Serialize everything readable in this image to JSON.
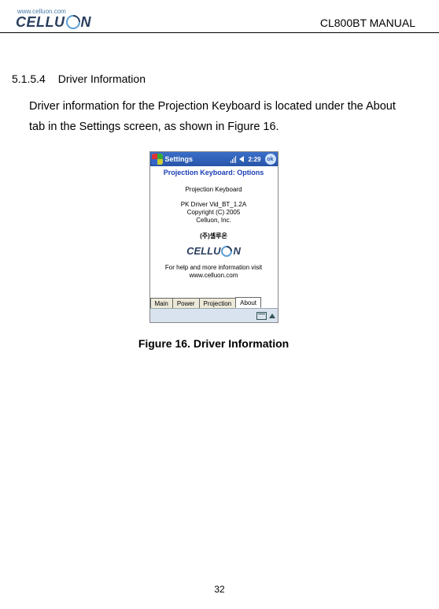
{
  "header": {
    "logo_url": "www.celluon.com",
    "logo_text_1": "CELLU",
    "logo_text_2": "N",
    "doc_title": "CL800BT MANUAL"
  },
  "section": {
    "number": "5.1.5.4",
    "title": "Driver Information"
  },
  "body_text": "Driver information for the Projection Keyboard is located under the About tab in the Settings screen, as shown in Figure 16.",
  "screenshot": {
    "titlebar": {
      "app": "Settings",
      "time": "2:29",
      "ok": "ok"
    },
    "subtitle": "Projection Keyboard: Options",
    "lines": {
      "l1": "Projection Keyboard",
      "l2": "PK Driver Vid_BT_1.2A",
      "l3": "Copyright (C) 2005",
      "l4": "Celluon, Inc."
    },
    "korean": "(주)셀루온",
    "logo_text_1": "CELLU",
    "logo_text_2": "N",
    "footer_lines": {
      "f1": "For help and more information visit",
      "f2": "www.celluon.com"
    },
    "tabs": {
      "t1": "Main",
      "t2": "Power",
      "t3": "Projection",
      "t4": "About"
    }
  },
  "figure_caption": "Figure 16. Driver Information",
  "page_number": "32"
}
